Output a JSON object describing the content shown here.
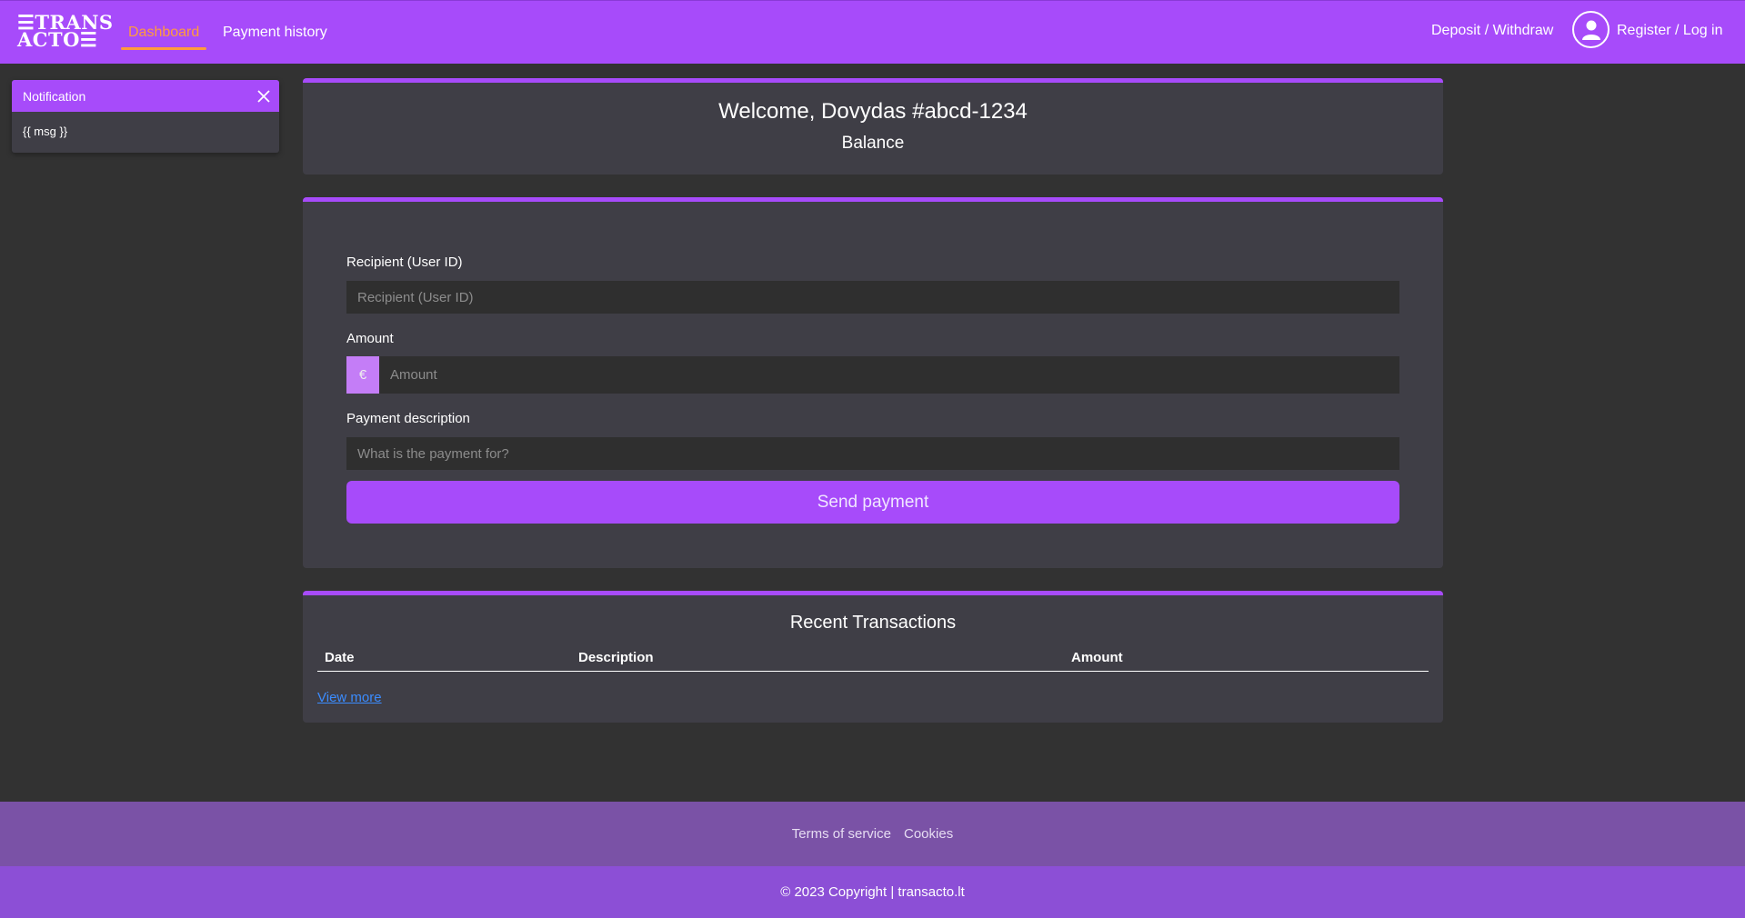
{
  "navbar": {
    "logo_line1": "☰TRANS",
    "logo_line2": "ACTO☰",
    "links": [
      {
        "label": "Dashboard",
        "active": true
      },
      {
        "label": "Payment history",
        "active": false
      }
    ],
    "deposit_label": "Deposit / Withdraw",
    "avatar_icon": "user-icon",
    "auth_label": "Register / Log in",
    "accent_color": "#a74bfa",
    "active_color": "#ff9b3d"
  },
  "notification": {
    "title": "Notification",
    "message": "{{ msg }}",
    "close_icon": "close-icon"
  },
  "welcome": {
    "greeting": "Welcome, Dovydas #abcd-1234",
    "balance_label": "Balance"
  },
  "payment_form": {
    "recipient_label": "Recipient (User ID)",
    "recipient_placeholder": "Recipient (User ID)",
    "amount_label": "Amount",
    "currency_symbol": "€",
    "amount_placeholder": "Amount",
    "description_label": "Payment description",
    "description_placeholder": "What is the payment for?",
    "submit_label": "Send payment"
  },
  "transactions": {
    "title": "Recent Transactions",
    "columns": [
      "Date",
      "Description",
      "Amount"
    ],
    "rows": [],
    "view_more_label": "View more"
  },
  "footer": {
    "links": [
      "Terms of service",
      "Cookies"
    ],
    "copyright": "© 2023 Copyright | transacto.lt"
  }
}
